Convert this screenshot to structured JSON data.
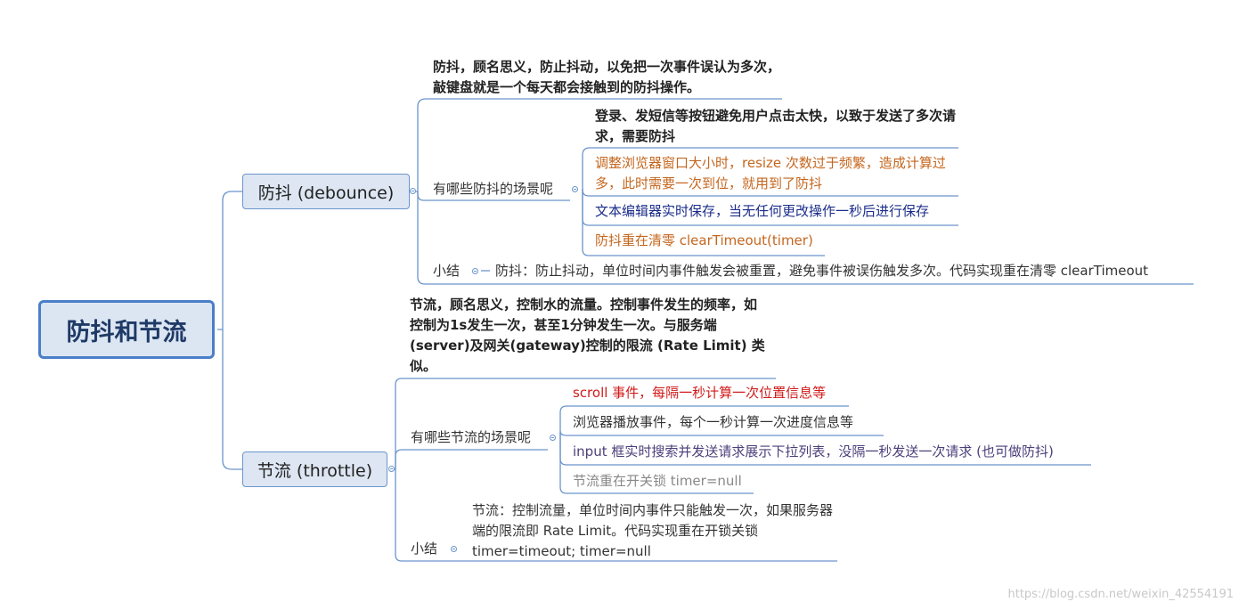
{
  "root": {
    "label": "防抖和节流"
  },
  "debounce": {
    "label": "防抖 (debounce)",
    "definition": "防抖，顾名思义，防止抖动，以免把一次事件误认为多次，敲键盘就是一个每天都会接触到的防抖操作。",
    "scenes_label": "有哪些防抖的场景呢",
    "scenes": [
      "登录、发短信等按钮避免用户点击太快，以致于发送了多次请求，需要防抖",
      "调整浏览器窗口大小时，resize 次数过于频繁，造成计算过多，此时需要一次到位，就用到了防抖",
      "文本编辑器实时保存，当无任何更改操作一秒后进行保存",
      "防抖重在清零 clearTimeout(timer)"
    ],
    "summary_label": "小结",
    "summary": "防抖：防止抖动，单位时间内事件触发会被重置，避免事件被误伤触发多次。代码实现重在清零 clearTimeout"
  },
  "throttle": {
    "label": "节流 (throttle)",
    "definition": "节流，顾名思义，控制水的流量。控制事件发生的频率，如控制为1s发生一次，甚至1分钟发生一次。与服务端(server)及网关(gateway)控制的限流 (Rate Limit) 类似。",
    "scenes_label": "有哪些节流的场景呢",
    "scenes": [
      "scroll 事件，每隔一秒计算一次位置信息等",
      "浏览器播放事件，每个一秒计算一次进度信息等",
      "input 框实时搜索并发送请求展示下拉列表，没隔一秒发送一次请求 (也可做防抖)",
      "节流重在开关锁 timer=null"
    ],
    "summary_label": "小结",
    "summary": "节流：控制流量，单位时间内事件只能触发一次，如果服务器端的限流即 Rate Limit。代码实现重在开锁关锁 timer=timeout; timer=null"
  },
  "watermark": "https://blog.csdn.net/weixin_42554191",
  "colors": {
    "line": "#6b95cc",
    "root_border": "#4a7fc8",
    "orange": "#c5661d",
    "navy": "#1b2d8a",
    "red": "#d11a1a",
    "gray": "#888888"
  }
}
